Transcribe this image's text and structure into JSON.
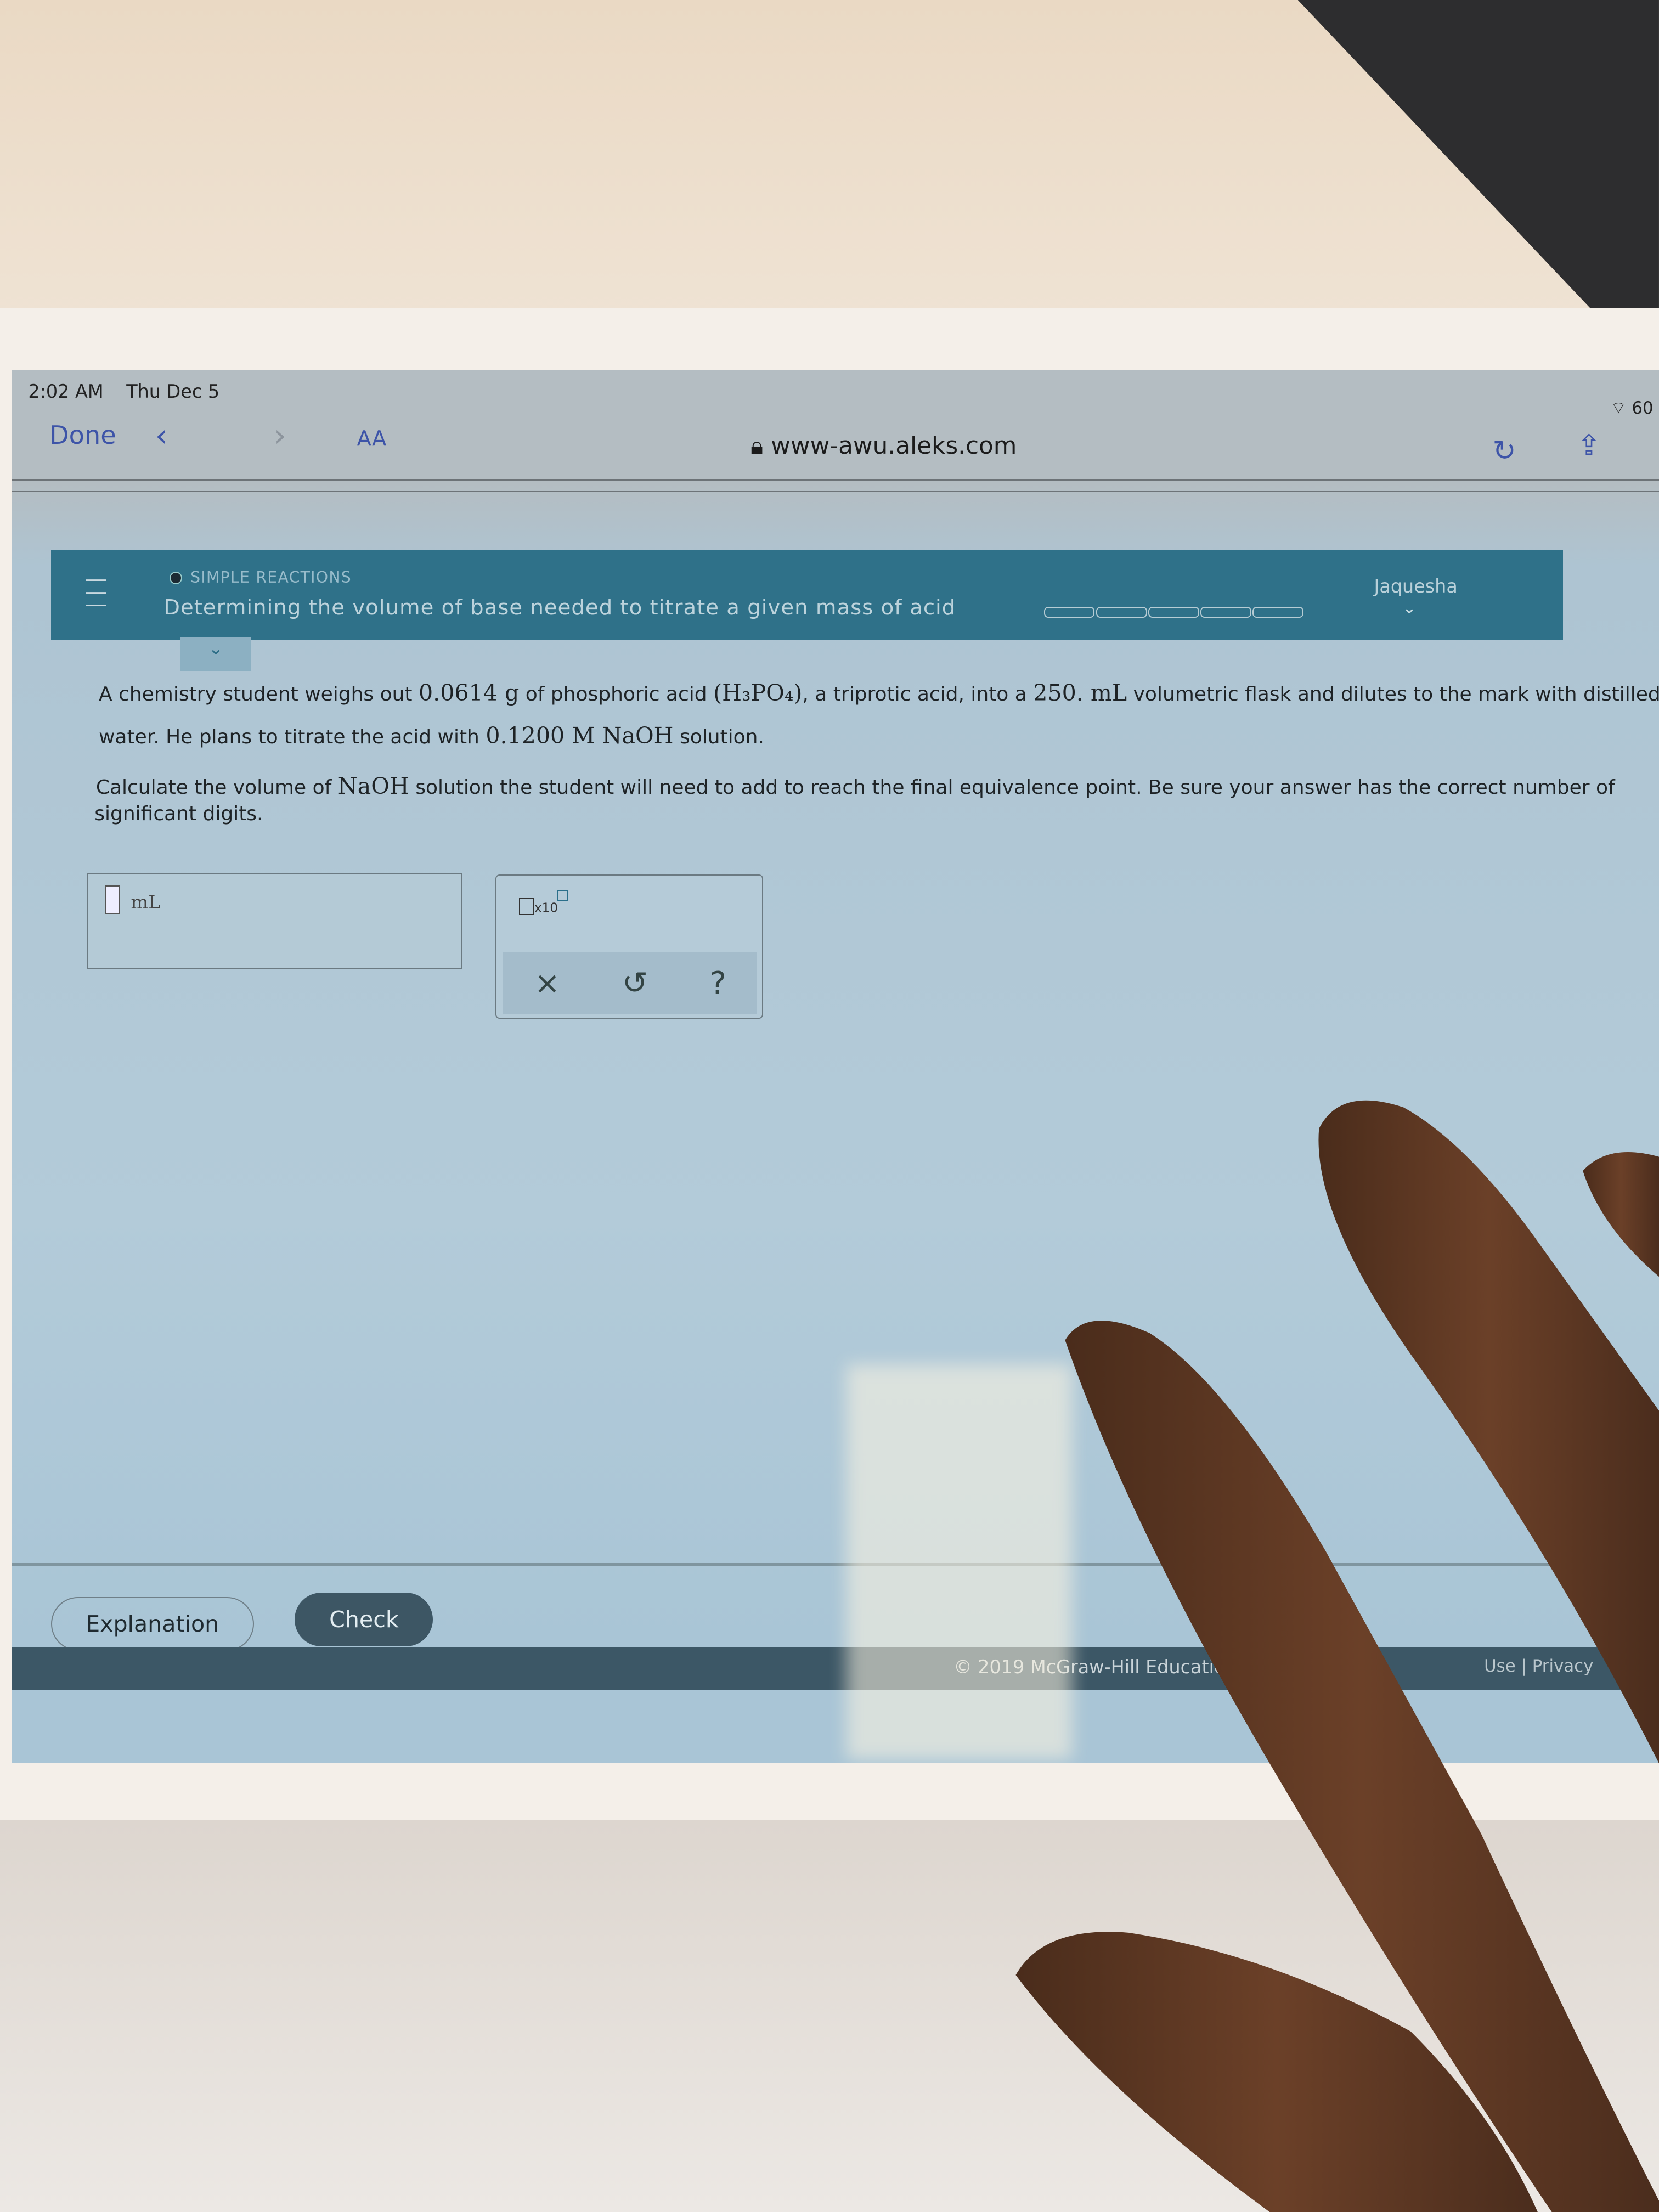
{
  "status_bar": {
    "time": "2:02 AM",
    "date": "Thu Dec 5",
    "battery": "60"
  },
  "browser": {
    "done_label": "Done",
    "back_icon": "‹",
    "forward_icon": "›",
    "text_size_label": "AA",
    "url": "www-awu.aleks.com",
    "reload_icon": "↻",
    "share_icon": "⇪"
  },
  "header": {
    "topic": "SIMPLE REACTIONS",
    "title": "Determining the volume of base needed to titrate a given mass of acid",
    "user": "Jaquesha",
    "progress_fraction": 0,
    "accent": "#2f7189"
  },
  "question": {
    "line1_a": "A chemistry student weighs out ",
    "mass": "0.0614",
    "unit_g": " g",
    "line1_b": " of phosphoric acid ",
    "formula": "(H₃PO₄)",
    "line1_c": ", a triprotic acid, into a ",
    "volume": "250. mL",
    "line1_d": " volumetric flask and dilutes to the mark with distilled",
    "line2_a": "water. He plans to titrate the acid with ",
    "conc": "0.1200 M NaOH",
    "line2_b": " solution.",
    "line3_a": "Calculate the volume of ",
    "naoh": "NaOH",
    "line3_b": " solution the student will need to add to reach the final equivalence point. Be sure your answer has the correct number of",
    "line4": "significant digits."
  },
  "answer": {
    "value": "",
    "unit": "mL"
  },
  "tools": {
    "sci_label": "x10",
    "clear_icon": "×",
    "undo_icon": "↺",
    "help_icon": "?"
  },
  "buttons": {
    "explanation": "Explanation",
    "check": "Check"
  },
  "footer": {
    "copyright": "© 2019 McGraw-Hill Education. A",
    "links": "Use  |  Privacy"
  }
}
